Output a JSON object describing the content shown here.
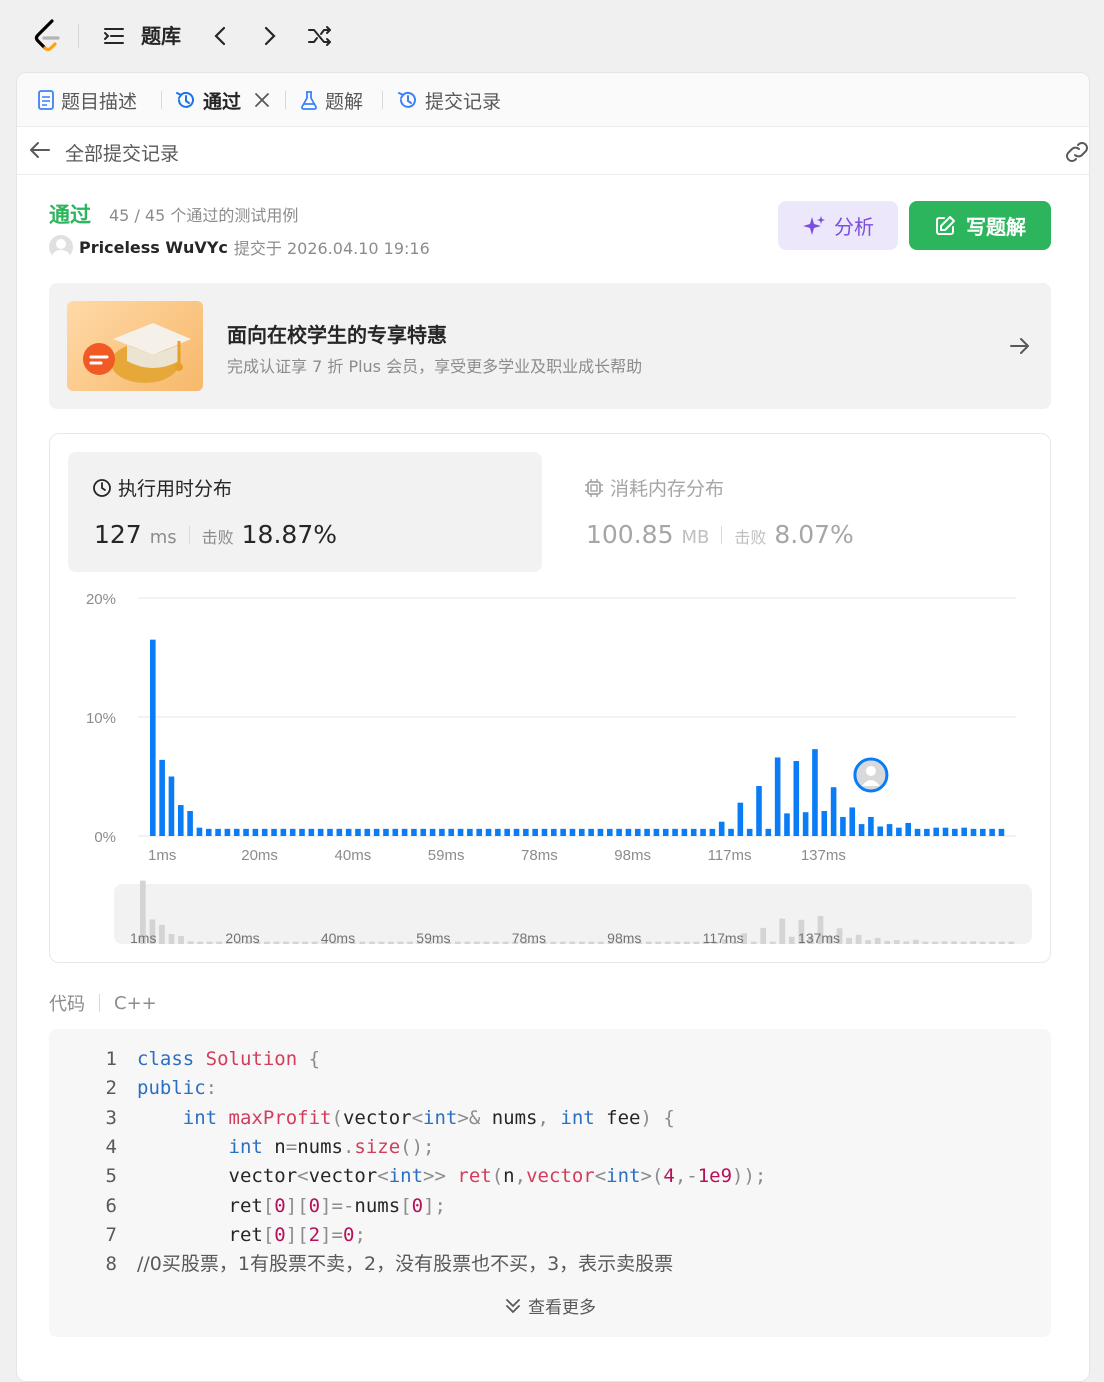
{
  "topbar": {
    "title": "题库",
    "icons": [
      "logo",
      "list-icon",
      "chevron-left-icon",
      "chevron-right-icon",
      "shuffle-icon"
    ]
  },
  "tabs": [
    {
      "label": "题目描述",
      "icon": "document-icon",
      "active": false
    },
    {
      "label": "通过",
      "icon": "history-icon",
      "active": true,
      "closable": true
    },
    {
      "label": "题解",
      "icon": "flask-icon",
      "active": false
    },
    {
      "label": "提交记录",
      "icon": "history-icon",
      "active": false
    }
  ],
  "subheader": {
    "title": "全部提交记录"
  },
  "result": {
    "status": "通过",
    "detail": "45 / 45 个通过的测试用例",
    "username": "Priceless WuVYc",
    "submitted": "提交于 2026.04.10 19:16"
  },
  "buttons": {
    "analyze": "分析",
    "write_solution": "写题解"
  },
  "promo": {
    "title": "面向在校学生的专享特惠",
    "subtitle": "完成认证享 7 折 Plus 会员，享受更多学业及职业成长帮助"
  },
  "runtime": {
    "label": "执行用时分布",
    "value": "127",
    "unit": "ms",
    "beat_label": "击败",
    "beat_pct": "18.87%"
  },
  "memory": {
    "label": "消耗内存分布",
    "value": "100.85",
    "unit": "MB",
    "beat_label": "击败",
    "beat_pct": "8.07%"
  },
  "chart_data": {
    "type": "bar",
    "x_tick_labels": [
      "1ms",
      "20ms",
      "40ms",
      "59ms",
      "78ms",
      "98ms",
      "117ms",
      "137ms"
    ],
    "y_tick_labels": [
      "20%",
      "10%",
      "0%"
    ],
    "ylim": [
      0,
      20
    ],
    "grid": true,
    "values": [
      16.5,
      6.4,
      5,
      2.6,
      2.1,
      0.7,
      0.6,
      0.6,
      0.6,
      0.6,
      0.6,
      0.6,
      0.6,
      0.6,
      0.6,
      0.6,
      0.6,
      0.6,
      0.6,
      0.6,
      0.6,
      0.6,
      0.6,
      0.6,
      0.6,
      0.6,
      0.6,
      0.6,
      0.6,
      0.6,
      0.6,
      0.6,
      0.6,
      0.6,
      0.6,
      0.6,
      0.6,
      0.6,
      0.6,
      0.6,
      0.6,
      0.6,
      0.6,
      0.6,
      0.6,
      0.6,
      0.6,
      0.6,
      0.6,
      0.6,
      0.6,
      0.6,
      0.6,
      0.6,
      0.6,
      0.6,
      0.6,
      0.6,
      0.6,
      0.6,
      0.6,
      1.2,
      0.6,
      2.8,
      0.6,
      4.2,
      0.6,
      6.6,
      1.9,
      6.3,
      2.0,
      7.3,
      2.1,
      4.1,
      1.6,
      2.4,
      1.0,
      1.6,
      0.8,
      1.0,
      0.7,
      1.1,
      0.6,
      0.6,
      0.7,
      0.7,
      0.6,
      0.7,
      0.6,
      0.6,
      0.6,
      0.6
    ],
    "highlight_index": 77,
    "bar_color": "#0a7cf5"
  },
  "code": {
    "label": "代码",
    "language": "C++",
    "more_label": "查看更多",
    "lines": [
      {
        "n": "1",
        "html": "<span class=\"kw\">class</span> <span class=\"cls\">Solution</span> <span class=\"pun\">{</span>"
      },
      {
        "n": "2",
        "html": "<span class=\"kw\">public</span><span class=\"pun\">:</span>"
      },
      {
        "n": "3",
        "html": "    <span class=\"kw\">int</span> <span class=\"fn\">maxProfit</span><span class=\"pun\">(</span>vector<span class=\"pun\">&lt;</span><span class=\"kw\">int</span><span class=\"pun\">&gt;&amp;</span> nums<span class=\"pun\">,</span> <span class=\"kw\">int</span> fee<span class=\"pun\">)</span> <span class=\"pun\">{</span>"
      },
      {
        "n": "4",
        "html": "        <span class=\"kw\">int</span> n<span class=\"pun\">=</span>nums<span class=\"pun\">.</span><span class=\"fn\">size</span><span class=\"pun\">();</span>"
      },
      {
        "n": "5",
        "html": "        vector<span class=\"pun\">&lt;</span>vector<span class=\"pun\">&lt;</span><span class=\"kw\">int</span><span class=\"pun\">&gt;&gt;</span> <span class=\"fn\">ret</span><span class=\"pun\">(</span>n<span class=\"pun\">,</span><span class=\"fn\">vector</span><span class=\"pun\">&lt;</span><span class=\"kw\">int</span><span class=\"pun\">&gt;(</span><span class=\"num\">4</span><span class=\"pun\">,-</span><span class=\"num\">1e9</span><span class=\"pun\">));</span>"
      },
      {
        "n": "6",
        "html": "        ret<span class=\"pun\">[</span><span class=\"num\">0</span><span class=\"pun\">][</span><span class=\"num\">0</span><span class=\"pun\">]=-</span>nums<span class=\"pun\">[</span><span class=\"num\">0</span><span class=\"pun\">];</span>"
      },
      {
        "n": "7",
        "html": "        ret<span class=\"pun\">[</span><span class=\"num\">0</span><span class=\"pun\">][</span><span class=\"num\">2</span><span class=\"pun\">]=</span><span class=\"num\">0</span><span class=\"pun\">;</span>"
      },
      {
        "n": "8",
        "html": "<span class=\"cm\">//0买股票，1有股票不卖，2，没有股票也不买，3，表示卖股票</span>"
      }
    ]
  },
  "code_text": [
    "class Solution {",
    "public:",
    "    int maxProfit(vector<int>& nums, int fee) {",
    "        int n=nums.size();",
    "        vector<vector<int>> ret(n,vector<int>(4,-1e9));",
    "        ret[0][0]=-nums[0];",
    "        ret[0][2]=0;",
    "//0买股票，1有股票不卖，2，没有股票也不买，3，表示卖股票"
  ]
}
